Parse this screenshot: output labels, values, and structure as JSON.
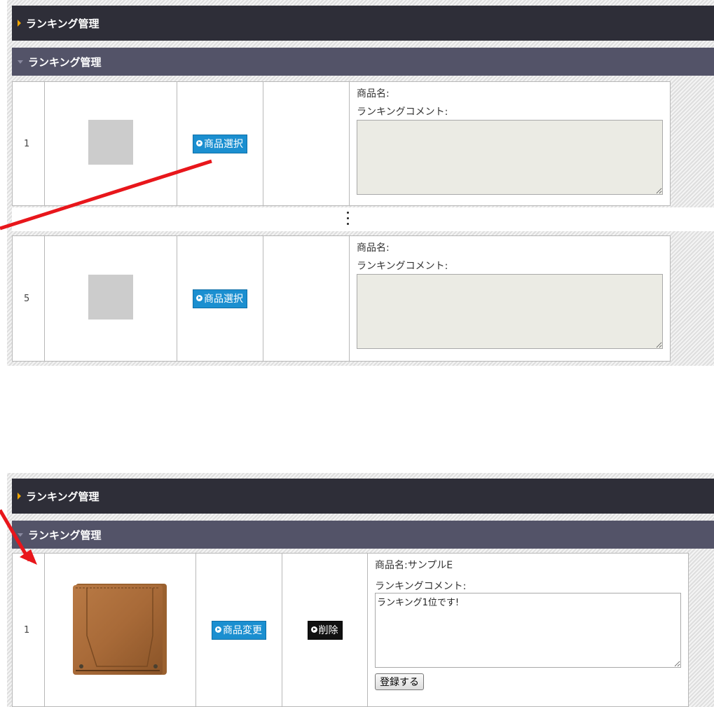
{
  "top_panel": {
    "header_title": "ランキング管理",
    "sub_header_title": "ランキング管理",
    "rows": [
      {
        "rank": "1",
        "select_label": "商品選択",
        "product_name_label": "商品名:",
        "comment_label": "ランキングコメント:",
        "comment_value": ""
      },
      {
        "rank": "5",
        "select_label": "商品選択",
        "product_name_label": "商品名:",
        "comment_label": "ランキングコメント:",
        "comment_value": ""
      }
    ]
  },
  "bottom_panel": {
    "header_title": "ランキング管理",
    "sub_header_title": "ランキング管理",
    "row": {
      "rank": "1",
      "change_label": "商品変更",
      "delete_label": "削除",
      "product_name": "商品名:サンプルE",
      "comment_label": "ランキングコメント:",
      "comment_value": "ランキング1位です!",
      "register_label": "登録する"
    }
  },
  "annotation_color": "#e8161b",
  "icons": [
    "play-circle-icon",
    "section-arrow-icon",
    "collapse-arrow-icon",
    "product-thumbnail-wallet"
  ]
}
